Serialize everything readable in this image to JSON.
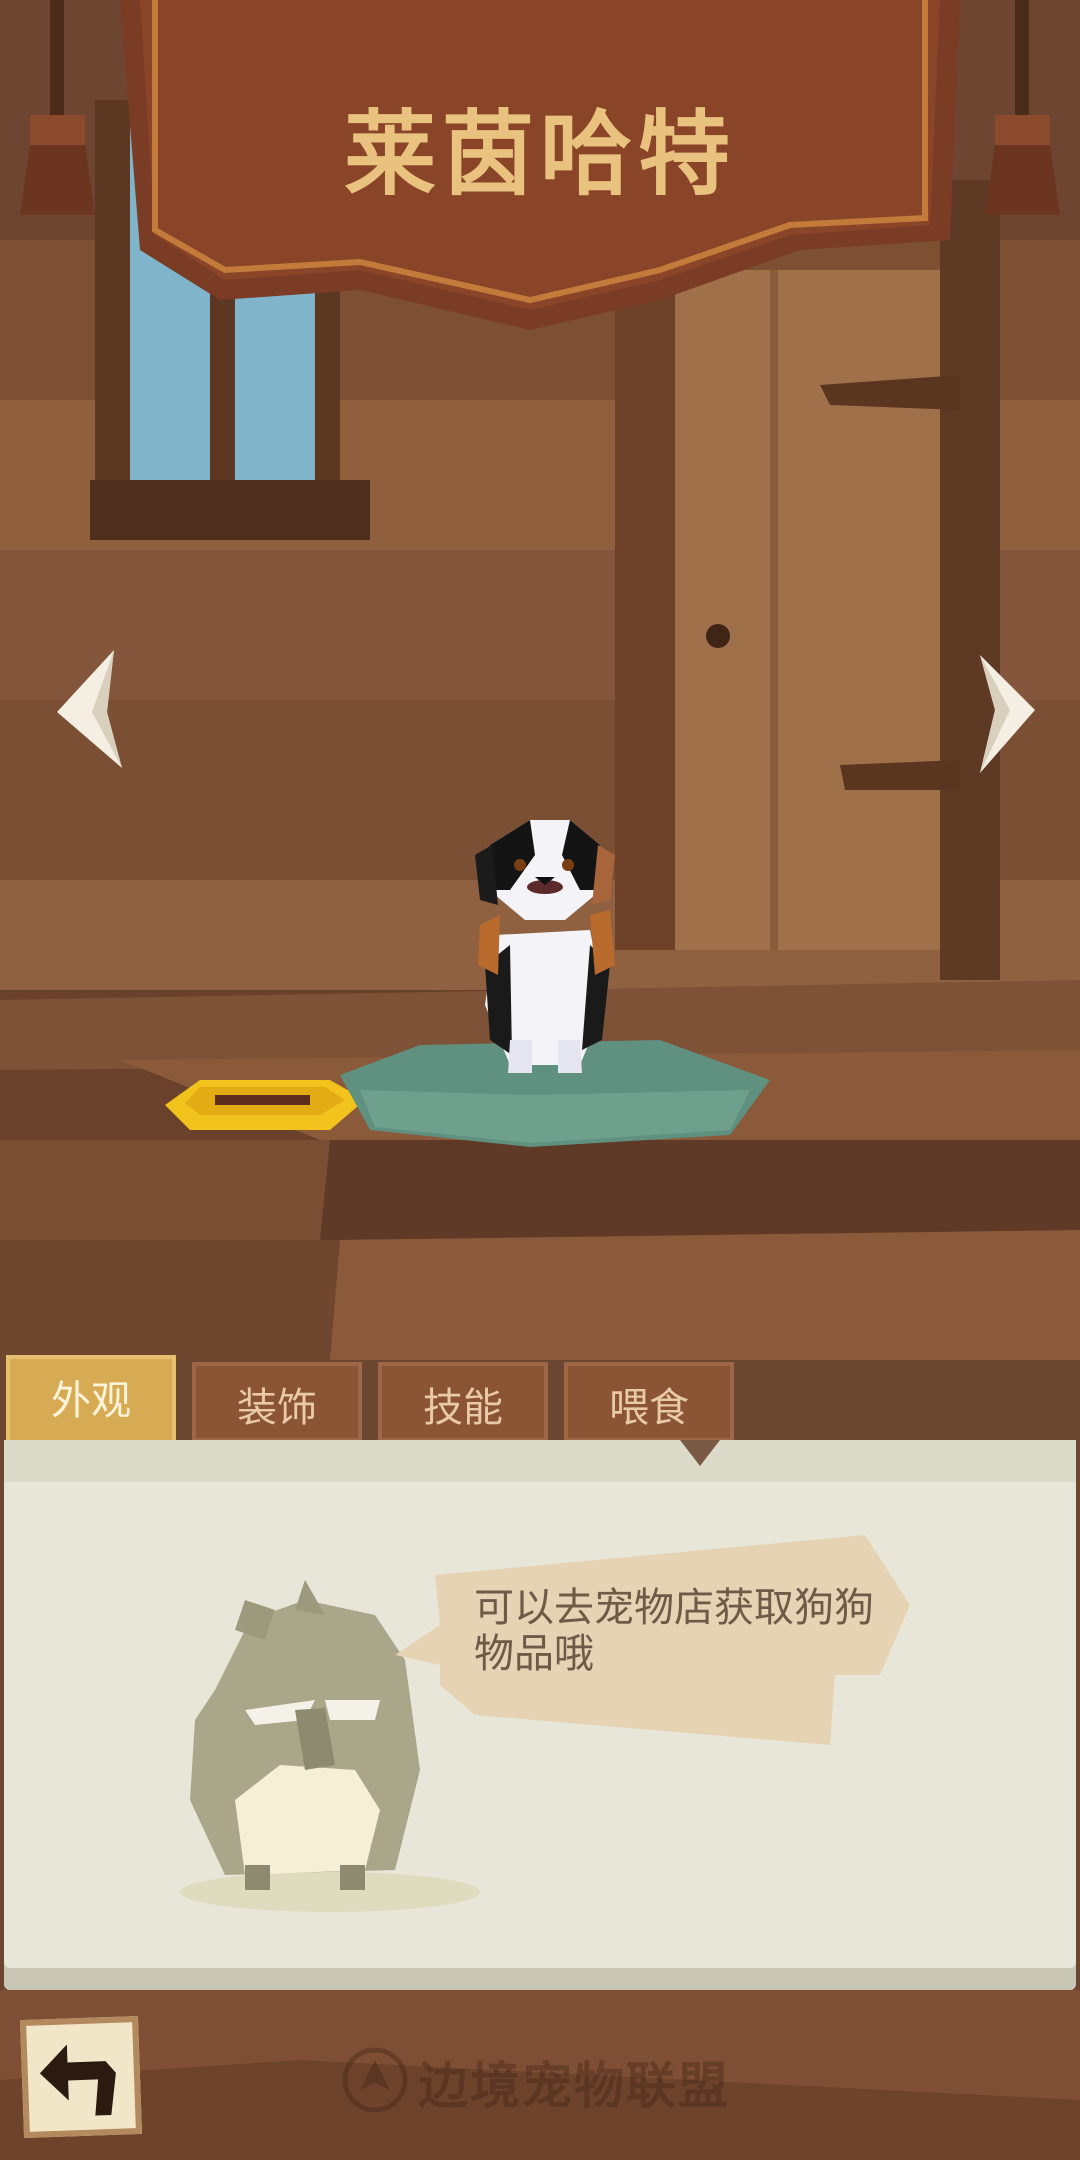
{
  "header": {
    "title": "莱茵哈特"
  },
  "nav": {
    "prev_icon": "chevron-left-icon",
    "next_icon": "chevron-right-icon"
  },
  "tabs": [
    {
      "label": "外观",
      "active": true
    },
    {
      "label": "装饰",
      "active": false
    },
    {
      "label": "技能",
      "active": false
    },
    {
      "label": "喂食",
      "active": false
    }
  ],
  "panel": {
    "speech": "可以去宠物店获取狗狗物品哦"
  },
  "footer": {
    "back_icon": "back-arrow-icon",
    "watermark": "边境宠物联盟"
  },
  "colors": {
    "wall": "#8a5a3a",
    "banner": "#7a3c25",
    "title": "#e8c27e",
    "panel": "#e7e6d8",
    "tab_active": "#d7ab54",
    "tab_inactive": "#8a5435"
  }
}
